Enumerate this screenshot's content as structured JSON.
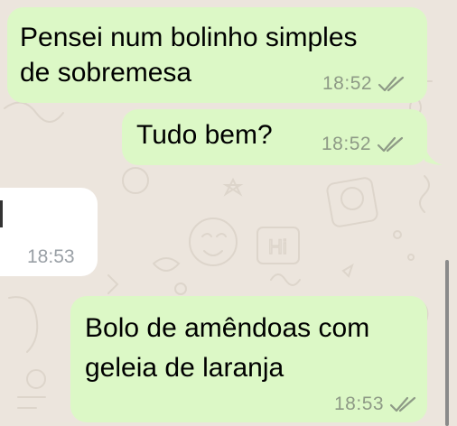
{
  "colors": {
    "outgoing_bubble": "#DCF8C6",
    "incoming_bubble": "#FFFFFF",
    "wallpaper": "#ECE5DD",
    "timestamp": "#8E9A86"
  },
  "messages": [
    {
      "direction": "outgoing",
      "lines": [
        "Pensei num bolinho simples",
        "de sobremesa"
      ],
      "time": "18:52",
      "status_icon": "double-check-icon"
    },
    {
      "direction": "outgoing",
      "lines": [
        "Tudo bem?"
      ],
      "time": "18:52",
      "status_icon": "double-check-icon"
    },
    {
      "direction": "incoming",
      "lines": [],
      "time": "18:53"
    },
    {
      "direction": "outgoing",
      "lines": [
        "Bolo de amêndoas com",
        "geleia de laranja"
      ],
      "time": "18:53",
      "status_icon": "double-check-icon"
    }
  ]
}
